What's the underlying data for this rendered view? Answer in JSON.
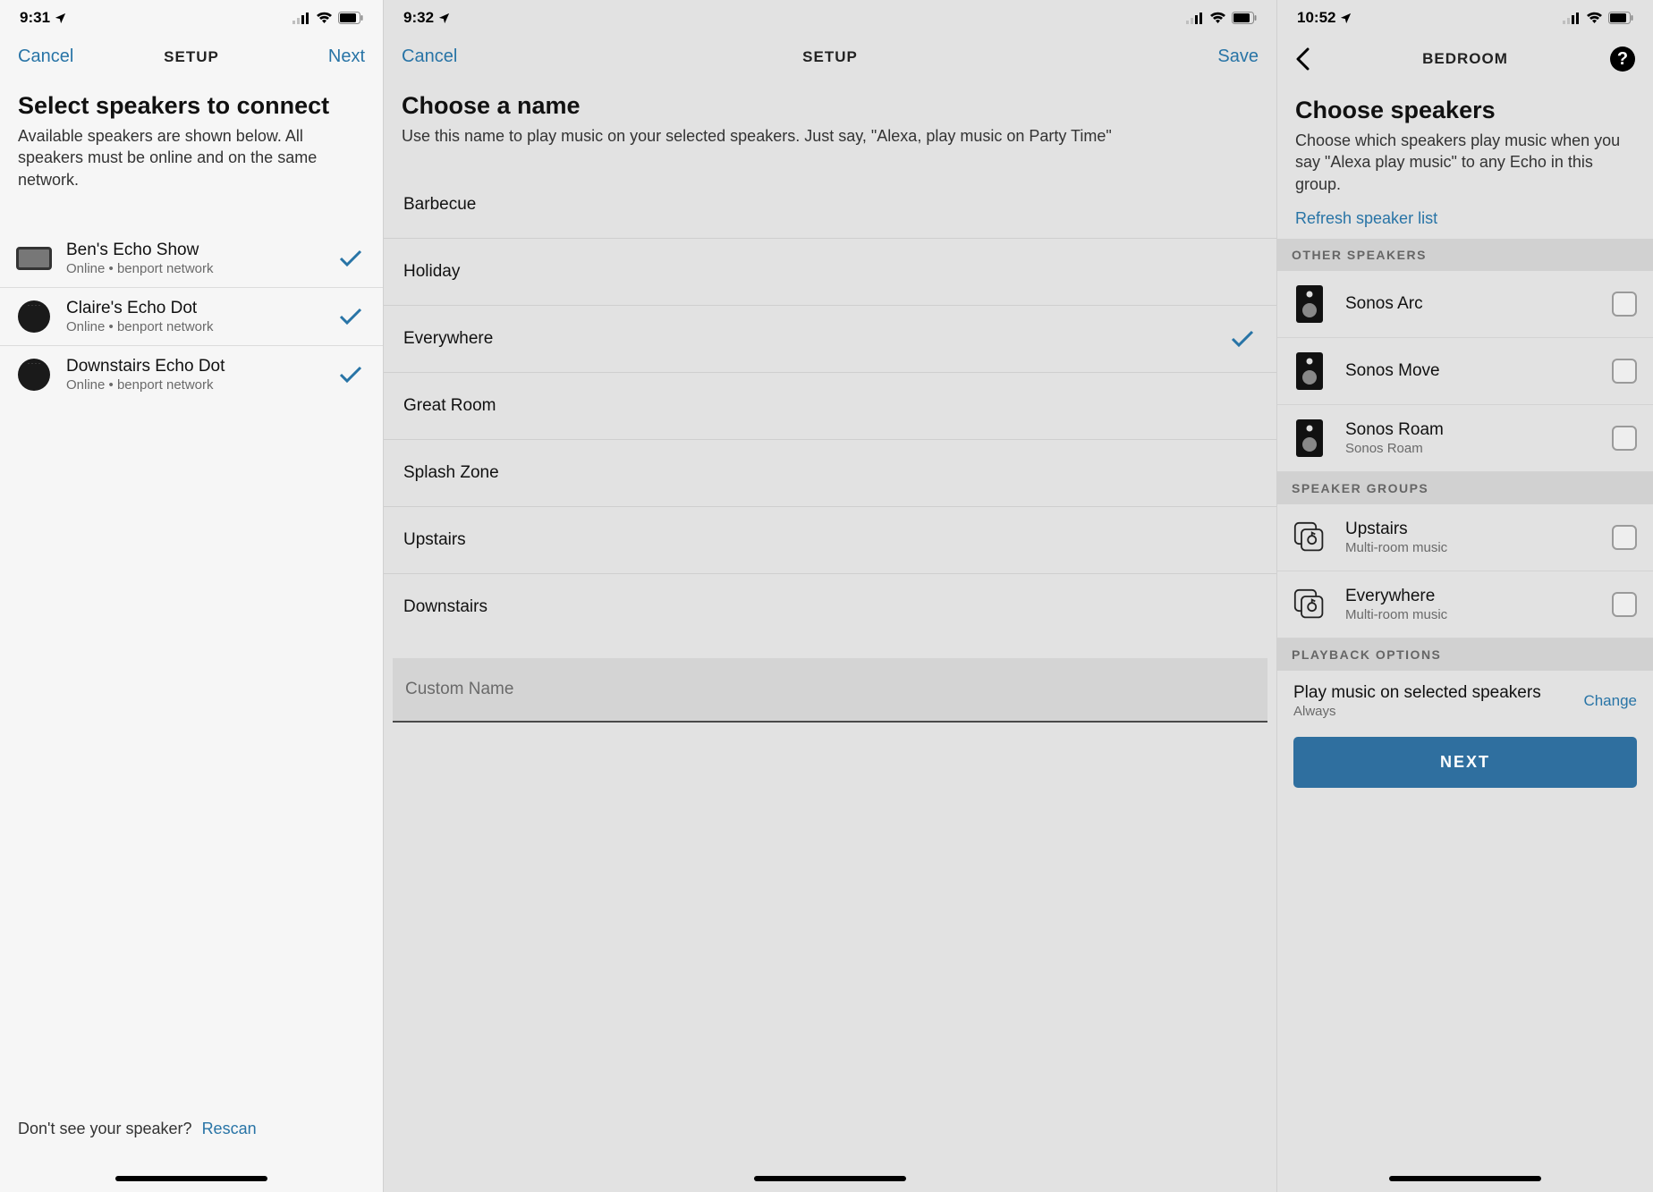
{
  "screens": {
    "a": {
      "status_time": "9:31",
      "nav_left": "Cancel",
      "nav_title": "SETUP",
      "nav_right": "Next",
      "heading": "Select speakers to connect",
      "subheading": "Available speakers are shown below. All speakers must be online and on the same network.",
      "devices": [
        {
          "name": "Ben's Echo Show",
          "sub": "Online • benport network"
        },
        {
          "name": "Claire's Echo Dot",
          "sub": "Online • benport network"
        },
        {
          "name": "Downstairs Echo Dot",
          "sub": "Online • benport network"
        }
      ],
      "footer_prompt": "Don't see your speaker?",
      "footer_link": "Rescan"
    },
    "b": {
      "status_time": "9:32",
      "nav_left": "Cancel",
      "nav_title": "SETUP",
      "nav_right": "Save",
      "heading": "Choose a name",
      "subheading": "Use this name to play music on your selected speakers. Just say, \"Alexa, play music on Party Time\"",
      "names": [
        "Barbecue",
        "Holiday",
        "Everywhere",
        "Great Room",
        "Splash Zone",
        "Upstairs",
        "Downstairs"
      ],
      "selected_index": 2,
      "custom_placeholder": "Custom Name"
    },
    "c": {
      "status_time": "10:52",
      "nav_title": "BEDROOM",
      "heading": "Choose speakers",
      "subheading": "Choose which speakers play music when you say \"Alexa play music\" to any Echo in this group.",
      "refresh_link": "Refresh speaker list",
      "section_other": "OTHER SPEAKERS",
      "other_speakers": [
        {
          "name": "Sonos Arc",
          "sub": ""
        },
        {
          "name": "Sonos Move",
          "sub": ""
        },
        {
          "name": "Sonos Roam",
          "sub": "Sonos Roam"
        }
      ],
      "section_groups": "SPEAKER GROUPS",
      "groups": [
        {
          "name": "Upstairs",
          "sub": "Multi-room music"
        },
        {
          "name": "Everywhere",
          "sub": "Multi-room music"
        }
      ],
      "section_playback": "PLAYBACK OPTIONS",
      "playback_title": "Play music on selected speakers",
      "playback_value": "Always",
      "change_link": "Change",
      "next_button": "NEXT"
    }
  }
}
